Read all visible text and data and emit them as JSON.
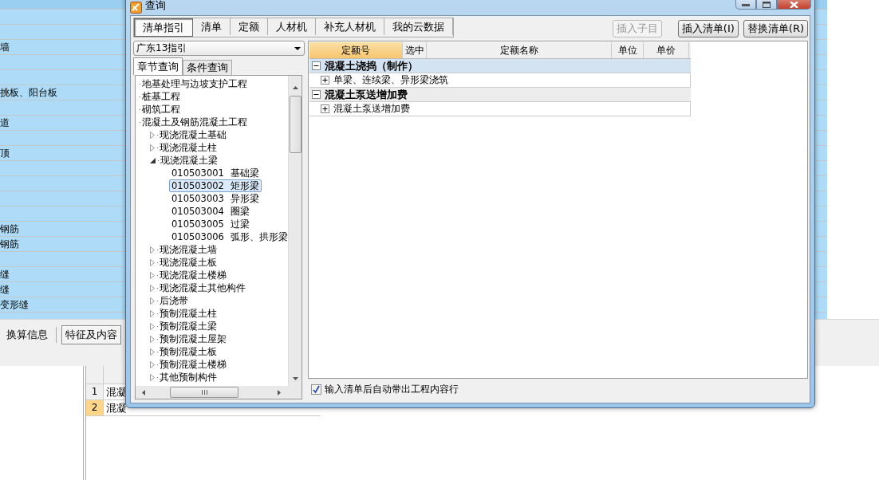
{
  "background": {
    "list_rows": [
      {},
      {},
      {
        "text": "墙"
      },
      {},
      {},
      {
        "text": "挑板、阳台板"
      },
      {},
      {
        "text": "道"
      },
      {},
      {
        "text": "顶"
      },
      {},
      {},
      {},
      {},
      {
        "text": "钢筋"
      },
      {
        "text": "钢筋"
      },
      {},
      {
        "text": "缝"
      },
      {
        "text": "缝"
      },
      {
        "text": "变形缝"
      }
    ],
    "bottom_tabs": [
      {
        "label": "换算信息",
        "selected": false
      },
      {
        "label": "特征及内容",
        "selected": true
      }
    ],
    "detail_rows": [
      {
        "number": "1",
        "text": "混凝",
        "selected": false
      },
      {
        "number": "2",
        "text": "混凝",
        "selected": true
      }
    ]
  },
  "dialog": {
    "title": "查询",
    "tabs": [
      {
        "label": "清单指引",
        "selected": true
      },
      {
        "label": "清单",
        "selected": false
      },
      {
        "label": "定额",
        "selected": false
      },
      {
        "label": "人材机",
        "selected": false
      },
      {
        "label": "补充人材机",
        "selected": false
      },
      {
        "label": "我的云数据",
        "selected": false
      }
    ],
    "buttons": [
      {
        "label": "插入子目",
        "disabled": true
      },
      {
        "label": "插入清单(I)",
        "disabled": false
      },
      {
        "label": "替换清单(R)",
        "disabled": false
      }
    ],
    "library": "广东13指引",
    "search_tabs": [
      {
        "label": "章节查询",
        "selected": true
      },
      {
        "label": "条件查询",
        "selected": false
      }
    ],
    "tree": [
      {
        "label": "地基处理与边坡支护工程"
      },
      {
        "label": "桩基工程"
      },
      {
        "label": "砌筑工程"
      },
      {
        "label": "混凝土及钢筋混凝土工程",
        "children": [
          {
            "label": "现浇混凝土基础",
            "expanded": false
          },
          {
            "label": "现浇混凝土柱",
            "expanded": false
          },
          {
            "label": "现浇混凝土梁",
            "expanded": true,
            "children": [
              {
                "code": "010503001",
                "name": "基础梁",
                "selected": false
              },
              {
                "code": "010503002",
                "name": "矩形梁",
                "selected": true
              },
              {
                "code": "010503003",
                "name": "异形梁",
                "selected": false
              },
              {
                "code": "010503004",
                "name": "圈梁",
                "selected": false
              },
              {
                "code": "010503005",
                "name": "过梁",
                "selected": false
              },
              {
                "code": "010503006",
                "name": "弧形、拱形梁",
                "selected": false
              }
            ]
          },
          {
            "label": "现浇混凝土墙",
            "expanded": false
          },
          {
            "label": "现浇混凝土板",
            "expanded": false
          },
          {
            "label": "现浇混凝土楼梯",
            "expanded": false
          },
          {
            "label": "现浇混凝土其他构件",
            "expanded": false
          },
          {
            "label": "后浇带",
            "expanded": false
          },
          {
            "label": "预制混凝土柱",
            "expanded": false
          },
          {
            "label": "预制混凝土梁",
            "expanded": false
          },
          {
            "label": "预制混凝土屋架",
            "expanded": false
          },
          {
            "label": "预制混凝土板",
            "expanded": false
          },
          {
            "label": "预制混凝土楼梯",
            "expanded": false
          },
          {
            "label": "其他预制构件",
            "expanded": false
          }
        ]
      }
    ],
    "table": {
      "columns": [
        {
          "label": "定额号",
          "selected": true
        },
        {
          "label": "选中",
          "selected": false
        },
        {
          "label": "定额名称",
          "selected": false
        },
        {
          "label": "单位",
          "selected": false
        },
        {
          "label": "单价",
          "selected": false
        }
      ],
      "rows": [
        {
          "kind": "group",
          "text": "混凝土浇捣（制作）",
          "selected": true
        },
        {
          "kind": "item",
          "text": "单梁、连续梁、异形梁浇筑"
        },
        {
          "kind": "group",
          "text": "混凝土泵送增加费",
          "selected": false
        },
        {
          "kind": "item",
          "text": "混凝土泵送增加费"
        }
      ]
    },
    "auto_insert": {
      "label": "输入清单后自动带出工程内容行",
      "checked": true
    }
  }
}
